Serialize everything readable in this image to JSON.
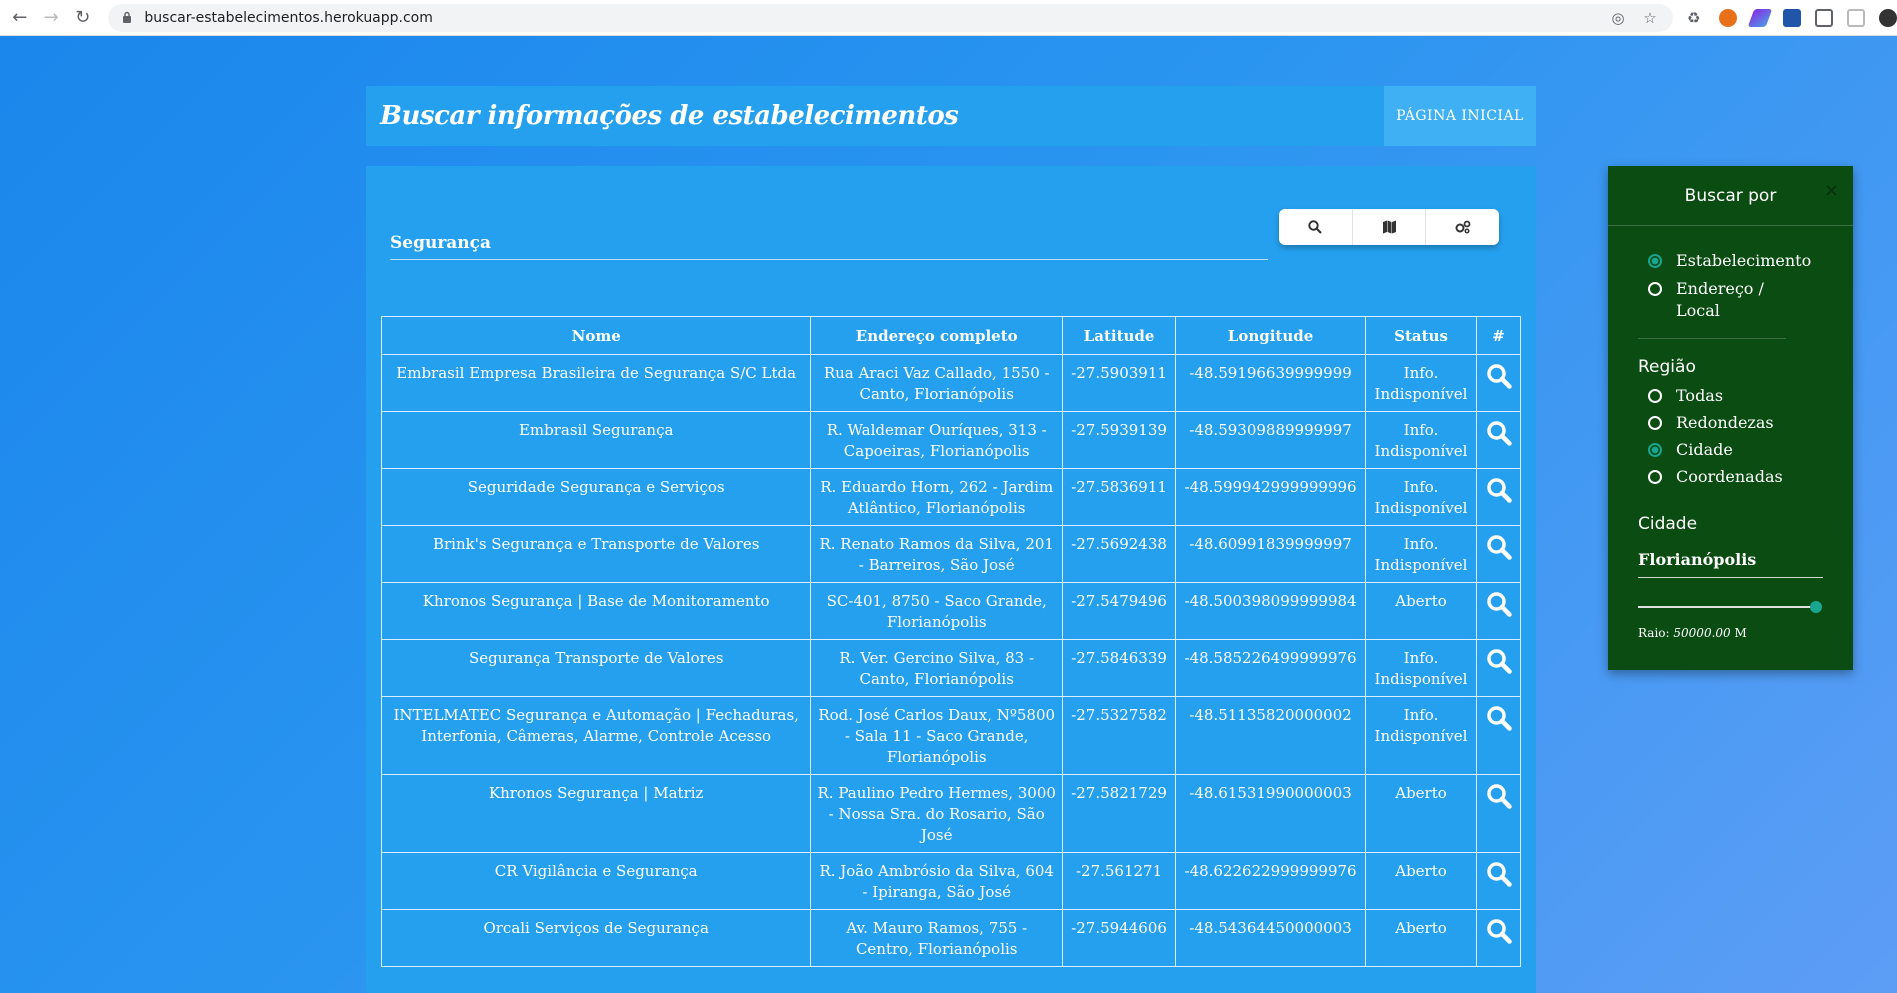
{
  "browser": {
    "url": "buscar-estabelecimentos.herokuapp.com"
  },
  "header": {
    "title": "Buscar informações de estabelecimentos",
    "home_link": "PÁGINA INICIAL"
  },
  "search": {
    "value": "Segurança"
  },
  "table": {
    "headers": [
      "Nome",
      "Endereço completo",
      "Latitude",
      "Longitude",
      "Status",
      "#"
    ],
    "rows": [
      {
        "nome": "Embrasil Empresa Brasileira de Segurança S/C Ltda",
        "endereco": "Rua Araci Vaz Callado, 1550 - Canto, Florianópolis",
        "lat": "-27.5903911",
        "lng": "-48.59196639999999",
        "status": "Info. Indisponível"
      },
      {
        "nome": "Embrasil Segurança",
        "endereco": "R. Waldemar Ouríques, 313 - Capoeiras, Florianópolis",
        "lat": "-27.5939139",
        "lng": "-48.59309889999997",
        "status": "Info. Indisponível"
      },
      {
        "nome": "Seguridade Segurança e Serviços",
        "endereco": "R. Eduardo Horn, 262 - Jardim Atlântico, Florianópolis",
        "lat": "-27.5836911",
        "lng": "-48.599942999999996",
        "status": "Info. Indisponível"
      },
      {
        "nome": "Brink's Segurança e Transporte de Valores",
        "endereco": "R. Renato Ramos da Silva, 201 - Barreiros, São José",
        "lat": "-27.5692438",
        "lng": "-48.60991839999997",
        "status": "Info. Indisponível"
      },
      {
        "nome": "Khronos Segurança | Base de Monitoramento",
        "endereco": "SC-401, 8750 - Saco Grande, Florianópolis",
        "lat": "-27.5479496",
        "lng": "-48.500398099999984",
        "status": "Aberto"
      },
      {
        "nome": "Segurança Transporte de Valores",
        "endereco": "R. Ver. Gercino Silva, 83 - Canto, Florianópolis",
        "lat": "-27.5846339",
        "lng": "-48.585226499999976",
        "status": "Info. Indisponível"
      },
      {
        "nome": "INTELMATEC Segurança e Automação | Fechaduras, Interfonia, Câmeras, Alarme, Controle Acesso",
        "endereco": "Rod. José Carlos Daux, Nº5800 - Sala 11 - Saco Grande, Florianópolis",
        "lat": "-27.5327582",
        "lng": "-48.51135820000002",
        "status": "Info. Indisponível"
      },
      {
        "nome": "Khronos Segurança | Matriz",
        "endereco": "R. Paulino Pedro Hermes, 3000 - Nossa Sra. do Rosario, São José",
        "lat": "-27.5821729",
        "lng": "-48.61531990000003",
        "status": "Aberto"
      },
      {
        "nome": "CR Vigilância e Segurança",
        "endereco": "R. João Ambrósio da Silva, 604 - Ipiranga, São José",
        "lat": "-27.561271",
        "lng": "-48.622622999999976",
        "status": "Aberto"
      },
      {
        "nome": "Orcali Serviços de Segurança",
        "endereco": "Av. Mauro Ramos, 755 - Centro, Florianópolis",
        "lat": "-27.5944606",
        "lng": "-48.54364450000003",
        "status": "Aberto"
      }
    ]
  },
  "panel": {
    "title": "Buscar por",
    "close": "×",
    "search_by": [
      {
        "label": "Estabelecimento",
        "selected": true
      },
      {
        "label": "Endereço / Local",
        "selected": false
      }
    ],
    "region_title": "Região",
    "regions": [
      {
        "label": "Todas",
        "selected": false
      },
      {
        "label": "Redondezas",
        "selected": false
      },
      {
        "label": "Cidade",
        "selected": true
      },
      {
        "label": "Coordenadas",
        "selected": false
      }
    ],
    "city_title": "Cidade",
    "city_value": "Florianópolis",
    "raio_label": "Raio:",
    "raio_value": "50000.00",
    "raio_unit": "M",
    "slider_fraction": 1.0
  },
  "colors": {
    "accent": "#1aa591",
    "panel_bg": "#0b4c12",
    "card_bg": "#25a0ee"
  }
}
